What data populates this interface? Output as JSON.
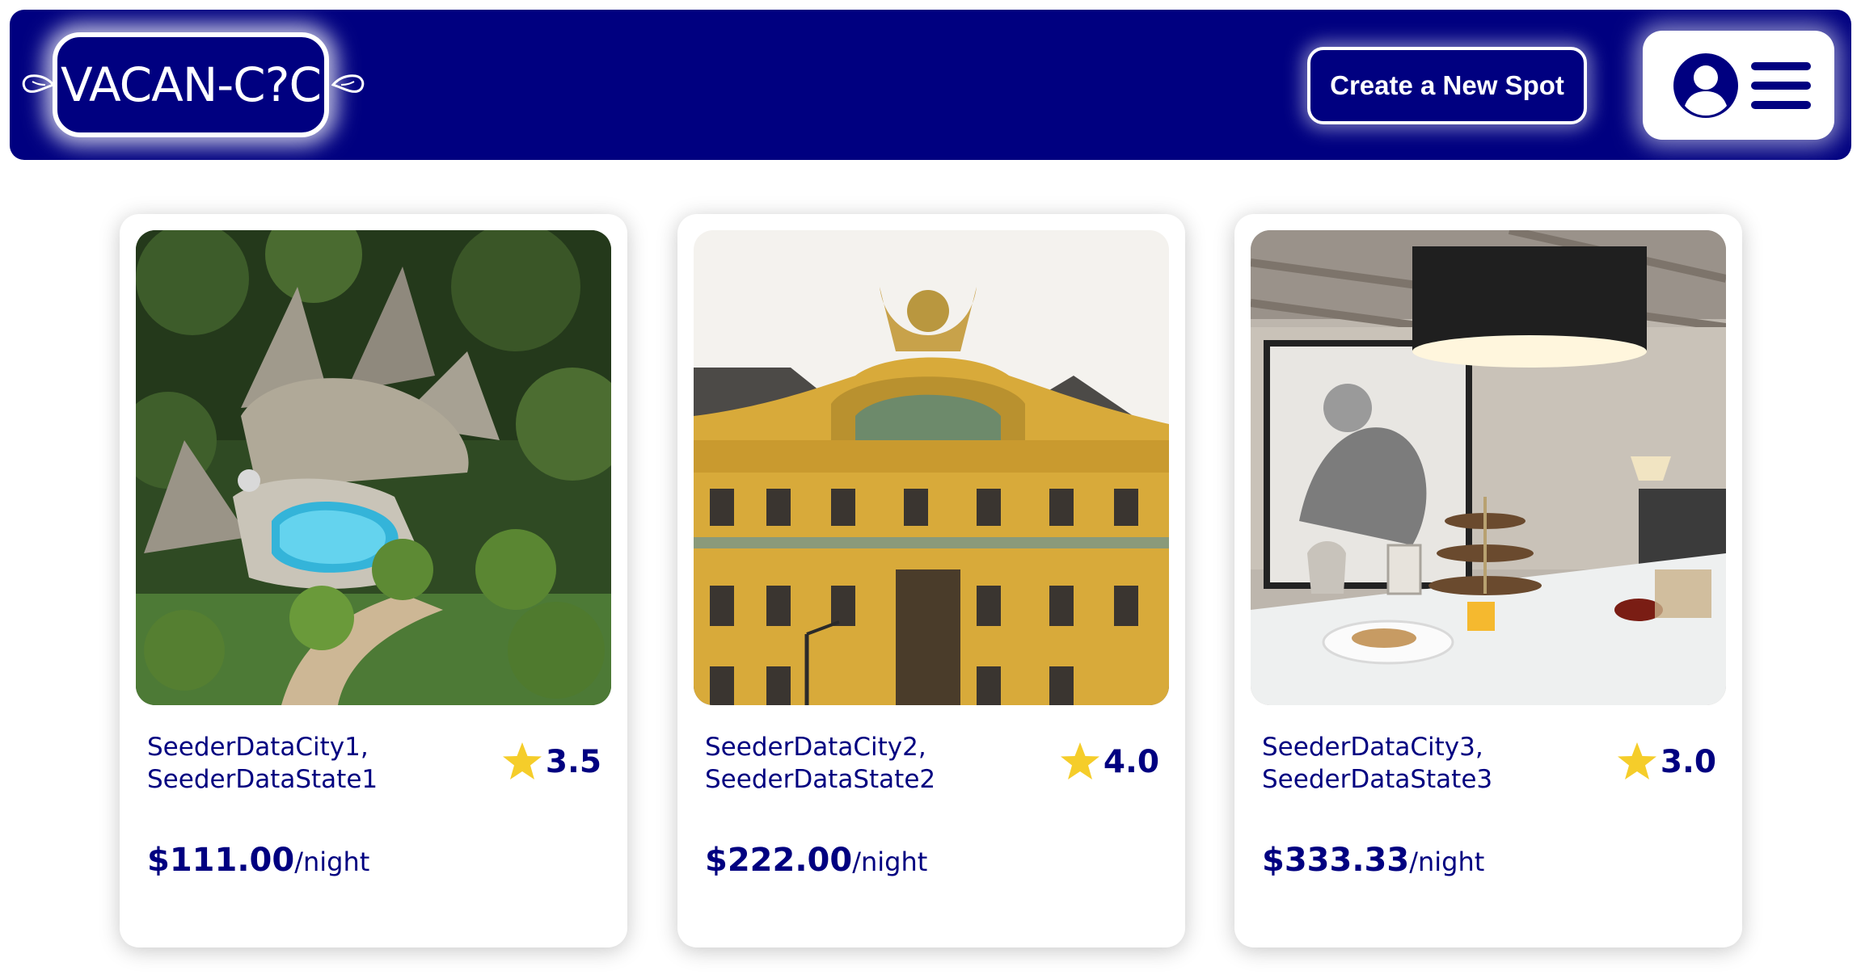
{
  "header": {
    "logo_text": "VACAN-C?C",
    "create_spot_label": "Create a New Spot",
    "profile_menu_icons": [
      "user-circle-icon",
      "hamburger-menu-icon"
    ]
  },
  "colors": {
    "brand": "#000080",
    "background": "#ffffff",
    "star": "#f5cd2a"
  },
  "spots": [
    {
      "city": "SeederDataCity1,",
      "state": "SeederDataState1",
      "rating": "3.5",
      "price": "$111.00",
      "price_unit": "/night"
    },
    {
      "city": "SeederDataCity2,",
      "state": "SeederDataState2",
      "rating": "4.0",
      "price": "$222.00",
      "price_unit": "/night"
    },
    {
      "city": "SeederDataCity3,",
      "state": "SeederDataState3",
      "rating": "3.0",
      "price": "$333.33",
      "price_unit": "/night"
    }
  ]
}
